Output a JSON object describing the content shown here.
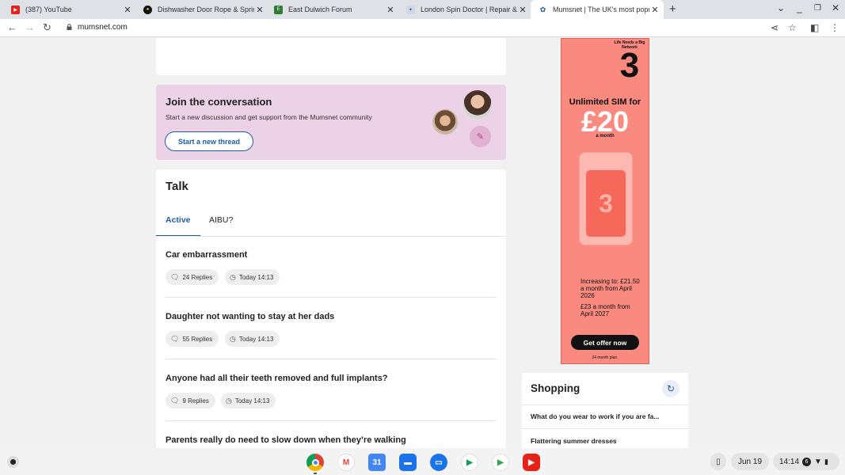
{
  "browser": {
    "tabs": [
      {
        "title": "(387) YouTube"
      },
      {
        "title": "Dishwasher Door Rope & Spring"
      },
      {
        "title": "East Dulwich Forum"
      },
      {
        "title": "London Spin Doctor | Repair & In"
      },
      {
        "title": "Mumsnet | The UK's most popula"
      }
    ],
    "url": "mumsnet.com"
  },
  "join": {
    "title": "Join the conversation",
    "text": "Start a new discussion and get support from the Mumsnet community",
    "button": "Start a new thread"
  },
  "talk": {
    "title": "Talk",
    "tabs": [
      "Active",
      "AIBU?"
    ],
    "threads": [
      {
        "title": "Car embarrassment",
        "replies": "24 Replies",
        "time": "Today 14:13"
      },
      {
        "title": "Daughter not wanting to stay at her dads",
        "replies": "55 Replies",
        "time": "Today 14:13"
      },
      {
        "title": "Anyone had all their teeth removed and full implants?",
        "replies": "9 Replies",
        "time": "Today 14:13"
      },
      {
        "title": "Parents really do need to slow down when they’re walking"
      }
    ]
  },
  "ad": {
    "tagline": "Life Needs a Big Network",
    "logo": "3",
    "headline": "Unlimited SIM for",
    "price": "£20",
    "per": "a month",
    "sim_logo": "3",
    "increase1": "Increasing to: £21.50 a month from April 2026",
    "increase2": "£23 a month from April 2027",
    "cta": "Get offer now",
    "small": "24 month plan."
  },
  "shopping": {
    "title": "Shopping",
    "items": [
      "What do you wear to work if you are fa...",
      "Flattering summer dresses"
    ]
  },
  "shelf": {
    "date": "Jun 19",
    "time": "14:14",
    "notifications": "6"
  },
  "colors": {
    "accent": "#1b5fa6",
    "join_bg": "#ecd2e6",
    "ad_bg": "#fa8a80"
  }
}
